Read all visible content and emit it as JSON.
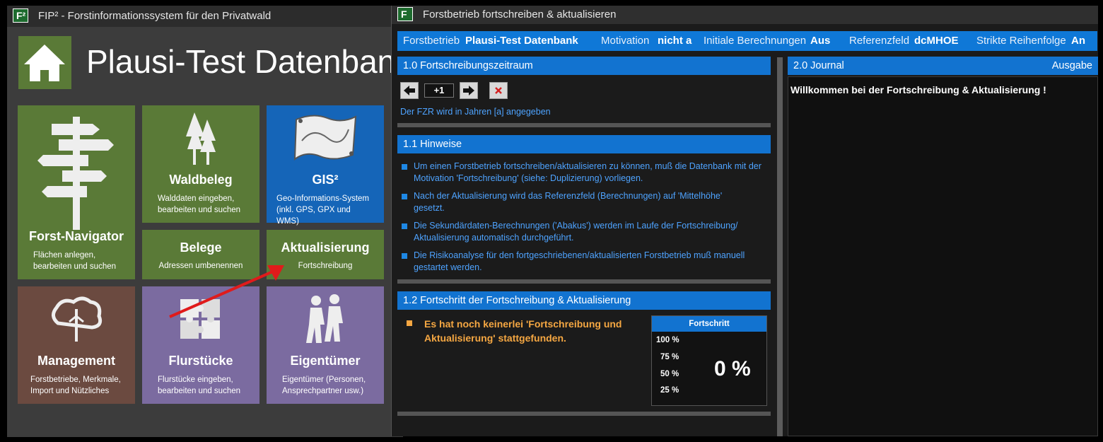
{
  "main_window": {
    "logo": "F²",
    "title": "FIP² - Forstinformationssystem für den Privatwald",
    "home_icon": "home-icon",
    "db_title": "Plausi-Test Datenbank",
    "tiles": [
      {
        "key": "forst-navigator",
        "title": "Forst-Navigator",
        "subtitle": "Flächen anlegen, bearbeiten und suchen",
        "icon": "signpost-icon",
        "color": "#5a7a37"
      },
      {
        "key": "waldbeleg",
        "title": "Waldbeleg",
        "subtitle": "Walddaten eingeben, bearbeiten und suchen",
        "icon": "trees-icon",
        "color": "#5a7a37"
      },
      {
        "key": "gis",
        "title": "GIS²",
        "subtitle": "Geo-Informations-System (inkl. GPS, GPX und WMS)",
        "icon": "map-icon",
        "color": "#1565b8"
      },
      {
        "key": "belege",
        "title": "Belege",
        "subtitle": "Adressen umbenennen",
        "color": "#5a7a37"
      },
      {
        "key": "aktualisierung",
        "title": "Aktualisierung",
        "subtitle": "Fortschreibung",
        "color": "#5a7a37"
      },
      {
        "key": "management",
        "title": "Management",
        "subtitle": "Forstbetriebe, Merkmale, Import und Nützliches",
        "icon": "management-icon",
        "color": "#6b4a40"
      },
      {
        "key": "flurstuecke",
        "title": "Flurstücke",
        "subtitle": "Flurstücke eingeben, bearbeiten und suchen",
        "icon": "puzzle-icon",
        "color": "#7b6ba0"
      },
      {
        "key": "eigentuemer",
        "title": "Eigentümer",
        "subtitle": "Eigentümer (Personen, Ansprechpartner usw.)",
        "icon": "people-icon",
        "color": "#7b6ba0"
      }
    ]
  },
  "secondary_window": {
    "logo": "F",
    "title": "Forstbetrieb fortschreiben & aktualisieren",
    "info_bar": [
      {
        "label": "Forstbetrieb",
        "value": "Plausi-Test Datenbank"
      },
      {
        "label": "Motivation",
        "value": "nicht a"
      },
      {
        "label": "Initiale Berechnungen",
        "value": "Aus"
      },
      {
        "label": "Referenzfeld",
        "value": "dcMHOE"
      },
      {
        "label": "Strikte Reihenfolge",
        "value": "An"
      }
    ],
    "section_zeitraum": {
      "title": "1.0 Fortschreibungszeitraum",
      "step_value": "+1",
      "note": "Der FZR wird in Jahren [a] angegeben"
    },
    "section_hinweise": {
      "title": "1.1 Hinweise",
      "items": [
        "Um einen Forstbetrieb fortschreiben/aktualisieren zu können, muß die Datenbank mit der Motivation 'Fortschreibung' (siehe: Duplizierung) vorliegen.",
        "Nach der Aktualisierung wird das Referenzfeld (Berechnungen) auf 'Mittelhöhe' gesetzt.",
        "Die Sekundärdaten-Berechnungen ('Abakus') werden im Laufe der Fortschreibung/ Aktualisierung automatisch durchgeführt.",
        "Die Risikoanalyse für den fortgeschriebenen/aktualisierten Forstbetrieb muß manuell gestartet werden."
      ]
    },
    "section_fortschritt": {
      "title": "1.2 Fortschritt der Fortschreibung & Aktualisierung",
      "message": "Es hat noch keinerlei 'Fortschreibung und Aktualisierung' stattgefunden.",
      "panel_title": "Fortschritt",
      "levels": [
        "100 %",
        "75 %",
        "50 %",
        "25 %"
      ],
      "percent_text": "0 %",
      "progress": 0
    },
    "journal": {
      "title": "2.0 Journal",
      "output_label": "Ausgabe",
      "welcome": "Willkommen bei der Fortschreibung & Aktualisierung !"
    }
  },
  "colors": {
    "accent_blue": "#0f78d7",
    "tile_green": "#5a7a37",
    "warning_orange": "#f5a742",
    "annotation_arrow": "#e01b1b"
  }
}
